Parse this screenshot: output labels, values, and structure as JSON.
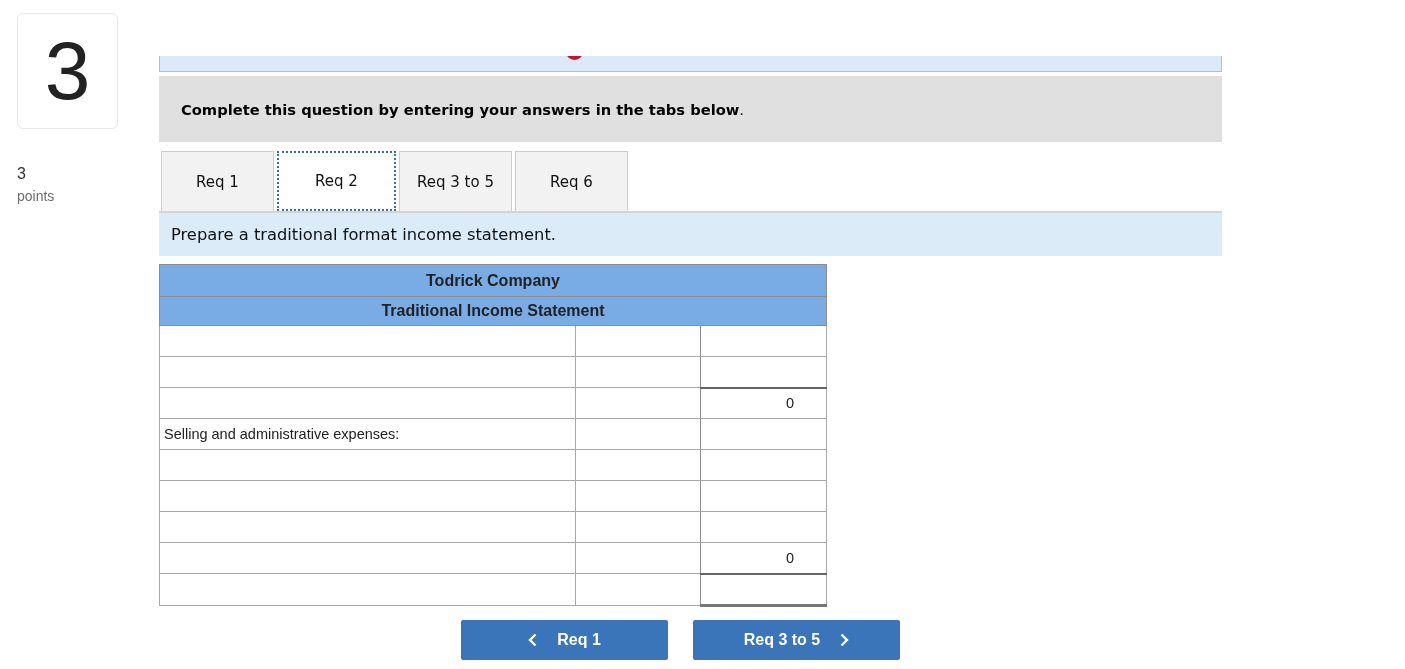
{
  "question": {
    "number": "3",
    "points_value": "3",
    "points_label": "points"
  },
  "instruction": "**Complete this question by entering your answers in the tabs below**.",
  "tabs": [
    {
      "label": "Req 1",
      "selected": false
    },
    {
      "label": "Req 2",
      "selected": true
    },
    {
      "label": "Req 3 to 5",
      "selected": false
    },
    {
      "label": "Req 6",
      "selected": false
    }
  ],
  "prompt": "Prepare a traditional format income statement.",
  "statement": {
    "title": "Todrick Company",
    "subtitle": "Traditional Income Statement",
    "rows": [
      {
        "cells": [
          {
            "kind": "input"
          },
          {
            "kind": "input"
          },
          {
            "kind": "input"
          }
        ],
        "rule_above": false,
        "rule_below": false
      },
      {
        "cells": [
          {
            "kind": "input"
          },
          {
            "kind": "input"
          },
          {
            "kind": "input"
          }
        ],
        "rule_above": false,
        "rule_below": false
      },
      {
        "cells": [
          {
            "kind": "input"
          },
          {
            "kind": "input"
          },
          {
            "kind": "text",
            "text": "0"
          }
        ],
        "rule_above": true,
        "rule_below": false
      },
      {
        "cells": [
          {
            "kind": "text",
            "text": "Selling and administrative expenses:"
          },
          {
            "kind": "input"
          },
          {
            "kind": "input"
          }
        ],
        "rule_above": false,
        "rule_below": false
      },
      {
        "cells": [
          {
            "kind": "input"
          },
          {
            "kind": "input"
          },
          {
            "kind": "input"
          }
        ],
        "rule_above": false,
        "rule_below": false
      },
      {
        "cells": [
          {
            "kind": "input"
          },
          {
            "kind": "input"
          },
          {
            "kind": "input"
          }
        ],
        "rule_above": false,
        "rule_below": false
      },
      {
        "cells": [
          {
            "kind": "input"
          },
          {
            "kind": "input"
          },
          {
            "kind": "input"
          }
        ],
        "rule_above": false,
        "rule_below": false
      },
      {
        "cells": [
          {
            "kind": "input"
          },
          {
            "kind": "input"
          },
          {
            "kind": "text",
            "text": "0"
          }
        ],
        "rule_above": false,
        "rule_below": false
      },
      {
        "cells": [
          {
            "kind": "input"
          },
          {
            "kind": "input"
          },
          {
            "kind": "input"
          }
        ],
        "rule_above": true,
        "rule_below": true
      }
    ]
  },
  "buttons": [
    {
      "kind": "previous",
      "label": "Req 1"
    },
    {
      "kind": "next",
      "label": "Req 3 to 5"
    }
  ]
}
